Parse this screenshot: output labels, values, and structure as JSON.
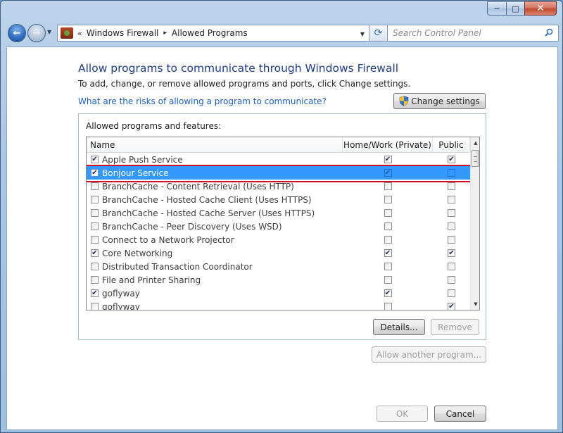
{
  "window": {
    "minimize_glyph": "─",
    "maximize_glyph": "□",
    "close_glyph": "✕"
  },
  "nav": {
    "back_glyph": "←",
    "forward_glyph": "→",
    "recent_glyph": "▼",
    "address_chevrons": "«",
    "breadcrumb": [
      "Windows Firewall",
      "Allowed Programs"
    ],
    "breadcrumb_sep": "▸",
    "address_dropdown_glyph": "▼",
    "refresh_glyph": "⟳",
    "search_placeholder": "Search Control Panel"
  },
  "page": {
    "heading": "Allow programs to communicate through Windows Firewall",
    "subtext": "To add, change, or remove allowed programs and ports, click Change settings.",
    "risk_link": "What are the risks of allowing a program to communicate?",
    "change_settings_label": "Change settings",
    "group_label": "Allowed programs and features:",
    "columns": {
      "name": "Name",
      "home": "Home/Work (Private)",
      "public": "Public"
    },
    "rows": [
      {
        "name": "Apple Push Service",
        "enabled": "✔",
        "home": "✔",
        "public": "✔"
      },
      {
        "name": "Bonjour Service",
        "enabled": "✔",
        "home": "✔",
        "public": ""
      },
      {
        "name": "BranchCache - Content Retrieval (Uses HTTP)",
        "enabled": "",
        "home": "",
        "public": ""
      },
      {
        "name": "BranchCache - Hosted Cache Client (Uses HTTPS)",
        "enabled": "",
        "home": "",
        "public": ""
      },
      {
        "name": "BranchCache - Hosted Cache Server (Uses HTTPS)",
        "enabled": "",
        "home": "",
        "public": ""
      },
      {
        "name": "BranchCache - Peer Discovery (Uses WSD)",
        "enabled": "",
        "home": "",
        "public": ""
      },
      {
        "name": "Connect to a Network Projector",
        "enabled": "",
        "home": "",
        "public": ""
      },
      {
        "name": "Core Networking",
        "enabled": "✔",
        "home": "✔",
        "public": "✔"
      },
      {
        "name": "Distributed Transaction Coordinator",
        "enabled": "",
        "home": "",
        "public": ""
      },
      {
        "name": "File and Printer Sharing",
        "enabled": "",
        "home": "",
        "public": ""
      },
      {
        "name": "goflyway",
        "enabled": "✔",
        "home": "✔",
        "public": ""
      },
      {
        "name": "goflyway",
        "enabled": "",
        "home": "",
        "public": "✔"
      }
    ],
    "scroll_up_glyph": "▲",
    "scroll_down_glyph": "▼",
    "details_label": "Details...",
    "remove_label": "Remove",
    "allow_another_label": "Allow another program...",
    "ok_label": "OK",
    "cancel_label": "Cancel"
  },
  "colors": {
    "heading": "#1e3c87",
    "link": "#1b5ec2",
    "selection": "#3399ff",
    "highlight_outline": "#d0102a"
  }
}
